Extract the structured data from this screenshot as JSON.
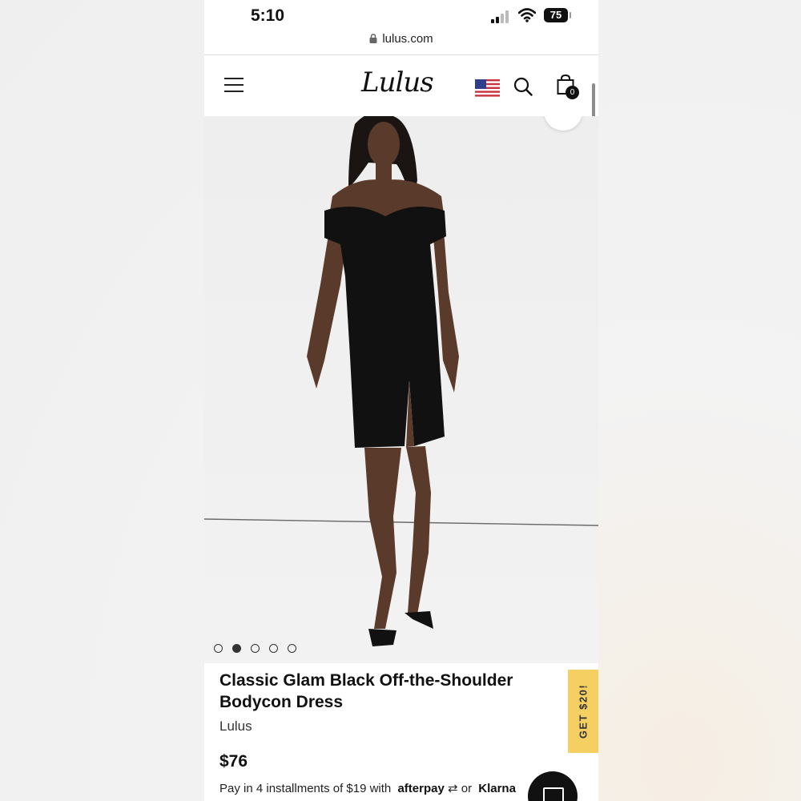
{
  "status_bar": {
    "time": "5:10",
    "battery": "75"
  },
  "browser": {
    "url": "lulus.com"
  },
  "header": {
    "logo": "Lulus",
    "flag_icon": "us-flag-icon",
    "search_icon": "search-icon",
    "bag_icon": "shopping-bag-icon",
    "bag_count": "0"
  },
  "gallery": {
    "image_count": 5,
    "active_index": 1
  },
  "product": {
    "title": "Classic Glam Black Off-the-Shoulder Bodycon Dress",
    "brand": "Lulus",
    "price": "$76",
    "installments_text": "Pay in 4 installments of $19 with",
    "afterpay": "afterpay",
    "or": "or",
    "klarna": "Klarna"
  },
  "promo": {
    "label": "GET $20!"
  },
  "colors": {
    "promo": "#f6cf63",
    "text": "#111111"
  }
}
